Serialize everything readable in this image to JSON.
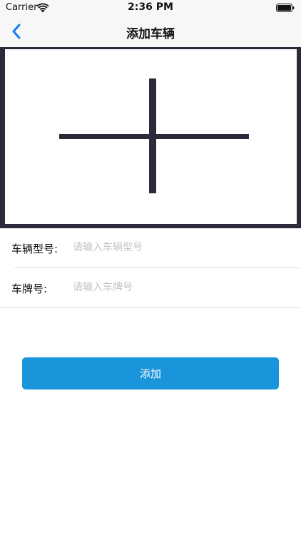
{
  "status_bar": {
    "carrier": "Carrier",
    "time": "2:36 PM",
    "wifi_icon": "wifi-icon",
    "battery_icon": "battery-icon"
  },
  "nav": {
    "title": "添加车辆",
    "back_icon": "chevron-left-icon",
    "accent_color": "#1a7cf5"
  },
  "image_picker": {
    "icon": "plus-icon",
    "frame_color": "#2b2b3b"
  },
  "form": {
    "model": {
      "label": "车辆型号:",
      "placeholder": "请输入车辆型号",
      "value": ""
    },
    "plate": {
      "label": "车牌号:",
      "placeholder": "请输入车牌号",
      "value": ""
    }
  },
  "add_button": {
    "label": "添加",
    "color": "#1a94da"
  }
}
